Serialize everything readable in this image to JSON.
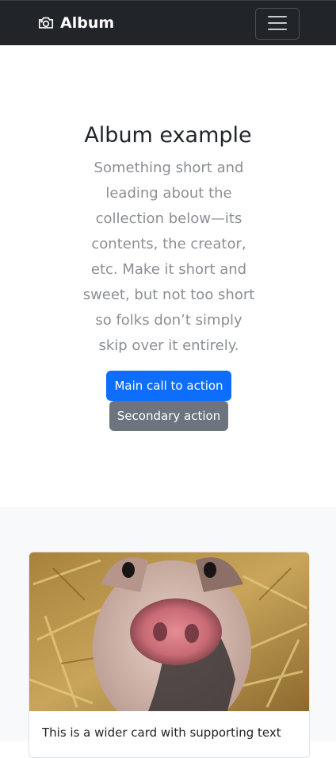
{
  "navbar": {
    "brand": "Album",
    "brand_icon": "camera-icon",
    "toggle_icon": "hamburger-menu-icon",
    "background": "#212529"
  },
  "hero": {
    "title": "Album example",
    "lead": "Something short and leading about the collection below—its contents, the creator, etc. Make it short and sweet, but not too short so folks don’t simply skip over it entirely.",
    "primary_button": "Main call to action",
    "secondary_button": "Secondary action"
  },
  "album": {
    "cards": [
      {
        "image": "piglet-photo",
        "text": "This is a wider card with supporting text"
      }
    ]
  },
  "colors": {
    "primary": "#0d6efd",
    "secondary": "#6c757d",
    "album_bg": "#f8f9fa"
  }
}
